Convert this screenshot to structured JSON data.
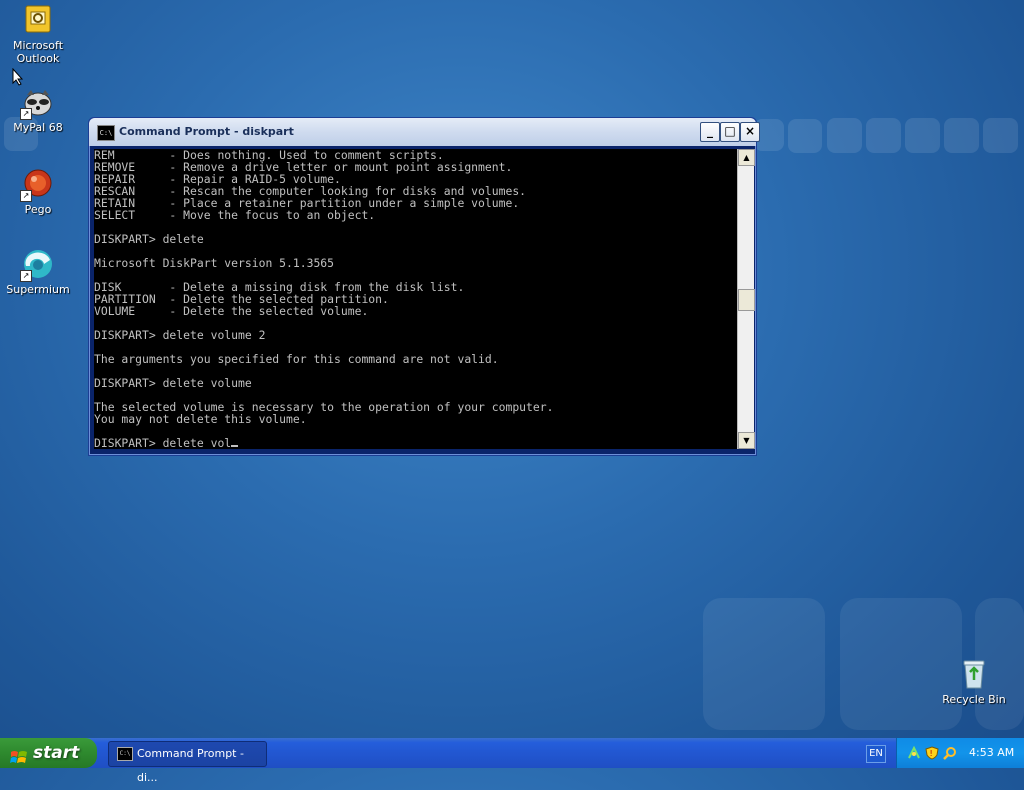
{
  "desktop": {
    "icons": [
      {
        "label": "Microsoft\nOutlook",
        "line1": "Microsoft",
        "line2": "Outlook"
      },
      {
        "label": "MyPal 68"
      },
      {
        "label": "Pego"
      },
      {
        "label": "Supermium"
      },
      {
        "label": "Recycle Bin"
      }
    ]
  },
  "window": {
    "title": "Command Prompt - diskpart",
    "title_icon": "C:\\",
    "minimize_label": "_",
    "maximize_label": "□",
    "close_label": "×",
    "console_lines": [
      "REM        - Does nothing. Used to comment scripts.",
      "REMOVE     - Remove a drive letter or mount point assignment.",
      "REPAIR     - Repair a RAID-5 volume.",
      "RESCAN     - Rescan the computer looking for disks and volumes.",
      "RETAIN     - Place a retainer partition under a simple volume.",
      "SELECT     - Move the focus to an object.",
      "",
      "DISKPART> delete",
      "",
      "Microsoft DiskPart version 5.1.3565",
      "",
      "DISK       - Delete a missing disk from the disk list.",
      "PARTITION  - Delete the selected partition.",
      "VOLUME     - Delete the selected volume.",
      "",
      "DISKPART> delete volume 2",
      "",
      "The arguments you specified for this command are not valid.",
      "",
      "DISKPART> delete volume",
      "",
      "The selected volume is necessary to the operation of your computer.",
      "You may not delete this volume.",
      ""
    ],
    "current_input": "DISKPART> delete vol",
    "scroll_up": "▲",
    "scroll_down": "▼"
  },
  "taskbar": {
    "start_label": "start",
    "task_label": "Command Prompt - di...",
    "task_icon": "C:\\",
    "language": "EN",
    "clock": "4:53 AM"
  }
}
